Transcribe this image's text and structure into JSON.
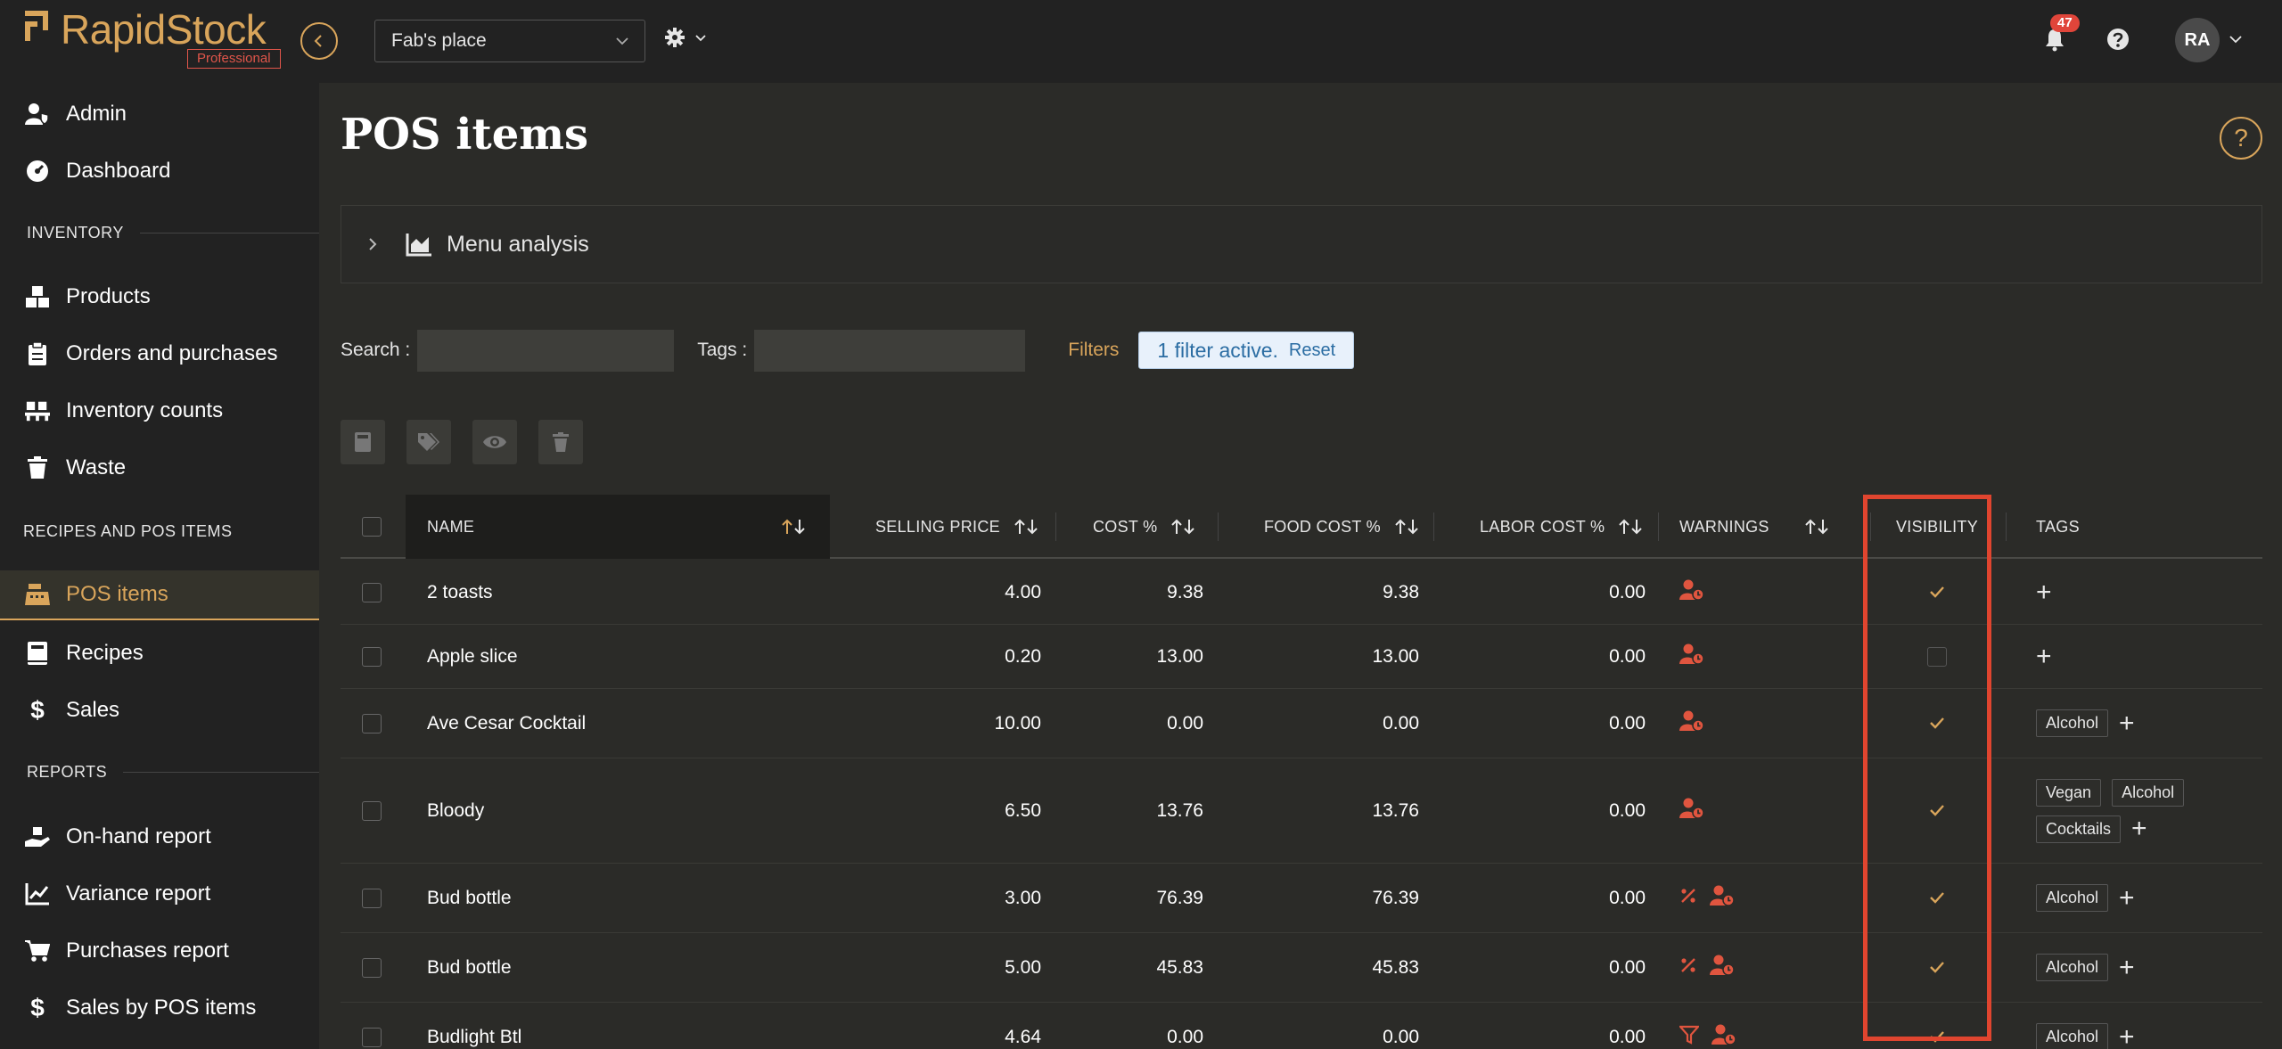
{
  "app": {
    "logo_text": "RapidStock",
    "logo_badge": "Professional",
    "location": "Fab's place",
    "notification_count": "47",
    "avatar_initials": "RA"
  },
  "sidebar": {
    "top_items": [
      {
        "label": "Admin",
        "icon": "user-shield-icon"
      },
      {
        "label": "Dashboard",
        "icon": "gauge-icon"
      }
    ],
    "section_inventory": "INVENTORY",
    "inventory_items": [
      {
        "label": "Products",
        "icon": "boxes-icon"
      },
      {
        "label": "Orders and purchases",
        "icon": "clipboard-icon"
      },
      {
        "label": "Inventory counts",
        "icon": "pallet-icon"
      },
      {
        "label": "Waste",
        "icon": "trash-icon"
      }
    ],
    "section_recipes": "RECIPES AND POS ITEMS",
    "recipes_items": [
      {
        "label": "POS items",
        "icon": "cash-register-icon",
        "active": true
      },
      {
        "label": "Recipes",
        "icon": "book-icon"
      },
      {
        "label": "Sales",
        "icon": "dollar-icon"
      }
    ],
    "section_reports": "REPORTS",
    "reports_items": [
      {
        "label": "On-hand report",
        "icon": "hand-box-icon"
      },
      {
        "label": "Variance report",
        "icon": "chart-line-icon"
      },
      {
        "label": "Purchases report",
        "icon": "cart-icon"
      },
      {
        "label": "Sales by POS items",
        "icon": "dollar-icon"
      }
    ]
  },
  "main": {
    "title": "POS items",
    "menu_analysis": "Menu analysis",
    "search_label": "Search :",
    "tags_label": "Tags :",
    "filters_label": "Filters",
    "filter_active": "1 filter active.",
    "reset_label": "Reset"
  },
  "table": {
    "headers": {
      "name": "NAME",
      "selling_price": "SELLING PRICE",
      "cost_pct": "COST %",
      "food_cost_pct": "FOOD COST %",
      "labor_cost_pct": "LABOR COST %",
      "warnings": "WARNINGS",
      "visibility": "VISIBILITY",
      "tags": "TAGS"
    },
    "rows": [
      {
        "name": "2 toasts",
        "price": "4.00",
        "cost": "9.38",
        "food": "9.38",
        "labor": "0.00",
        "warnings": [
          "user-clock"
        ],
        "visible": true,
        "tags": []
      },
      {
        "name": "Apple slice",
        "price": "0.20",
        "cost": "13.00",
        "food": "13.00",
        "labor": "0.00",
        "warnings": [
          "user-clock"
        ],
        "visible": false,
        "tags": []
      },
      {
        "name": "Ave Cesar Cocktail",
        "price": "10.00",
        "cost": "0.00",
        "food": "0.00",
        "labor": "0.00",
        "warnings": [
          "user-clock"
        ],
        "visible": true,
        "tags": [
          "Alcohol"
        ]
      },
      {
        "name": "Bloody",
        "price": "6.50",
        "cost": "13.76",
        "food": "13.76",
        "labor": "0.00",
        "warnings": [
          "user-clock"
        ],
        "visible": true,
        "tags": [
          "Vegan",
          "Alcohol",
          "Cocktails"
        ]
      },
      {
        "name": "Bud bottle",
        "price": "3.00",
        "cost": "76.39",
        "food": "76.39",
        "labor": "0.00",
        "warnings": [
          "percent",
          "user-clock"
        ],
        "visible": true,
        "tags": [
          "Alcohol"
        ]
      },
      {
        "name": "Bud bottle",
        "price": "5.00",
        "cost": "45.83",
        "food": "45.83",
        "labor": "0.00",
        "warnings": [
          "percent",
          "user-clock"
        ],
        "visible": true,
        "tags": [
          "Alcohol"
        ]
      },
      {
        "name": "Budlight Btl",
        "price": "4.64",
        "cost": "0.00",
        "food": "0.00",
        "labor": "0.00",
        "warnings": [
          "funnel",
          "user-clock"
        ],
        "visible": true,
        "tags": [
          "Alcohol"
        ]
      }
    ]
  },
  "colors": {
    "accent": "#d9a55b",
    "warning": "#e0553f",
    "highlight": "#e0452f"
  }
}
